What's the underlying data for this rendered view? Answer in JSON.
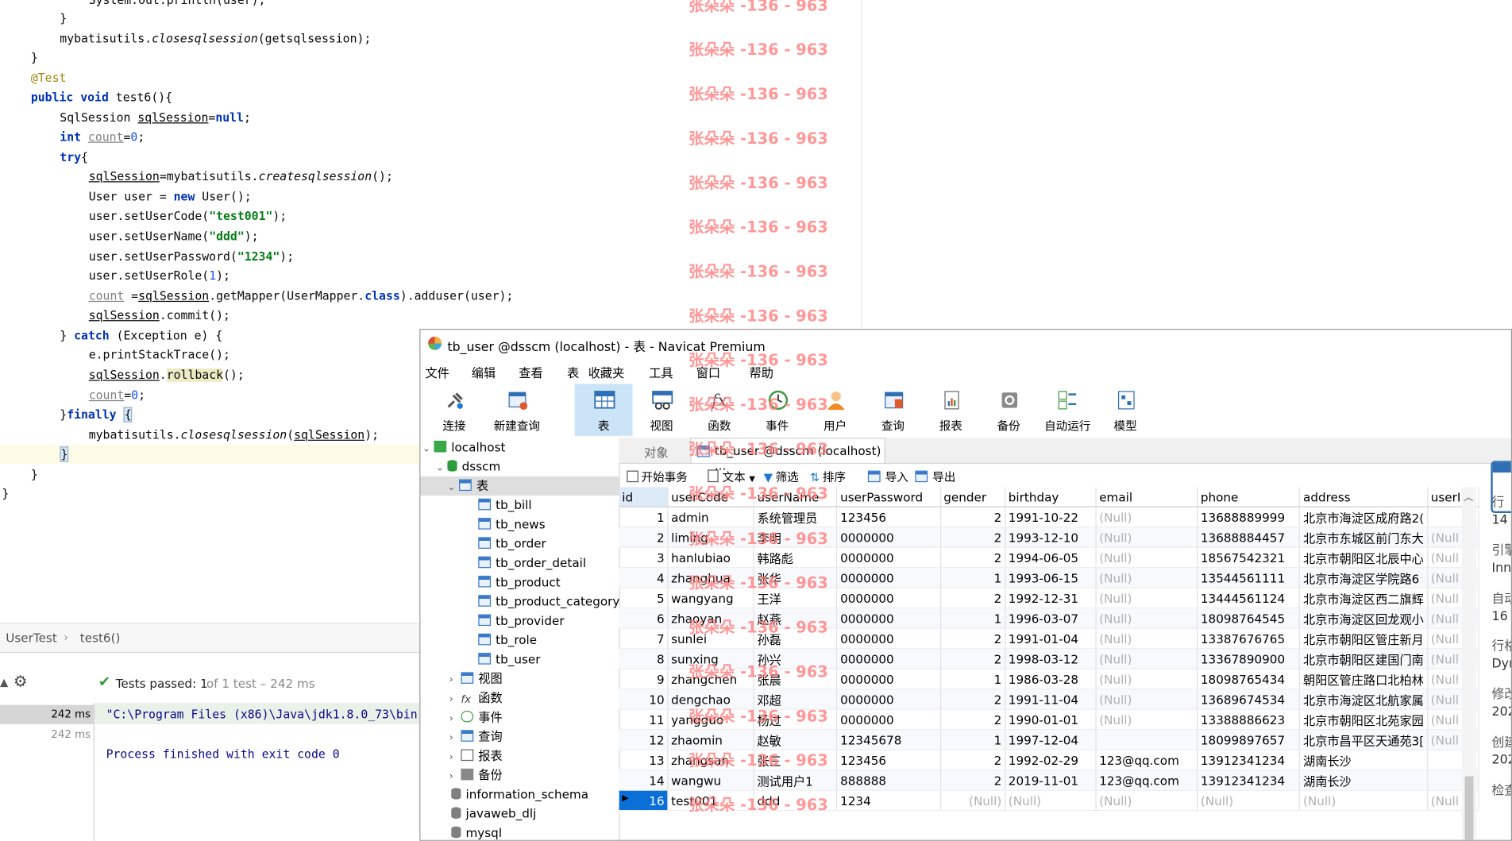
{
  "editor": {
    "lines": [
      "System.out.println(user);",
      "}",
      "mybatisutils.closesqlsession(getsqlsession);",
      "}",
      "@Test",
      "public void test6(){",
      "SqlSession sqlSession=null;",
      "int count=0;",
      "try{",
      "sqlSession=mybatisutils.createsqlsession();",
      "User user = new User();",
      "user.setUserCode(\"test001\");",
      "user.setUserName(\"ddd\");",
      "user.setUserPassword(\"1234\");",
      "user.setUserRole(1);",
      "count =sqlSession.getMapper(UserMapper.class).adduser(user);",
      "sqlSession.commit();",
      "} catch (Exception e) {",
      "e.printStackTrace();",
      "sqlSession.rollback();",
      "count=0;",
      "}finally {",
      "mybatisutils.closesqlsession(sqlSession);",
      "}",
      "}",
      "}"
    ]
  },
  "breadcrumb": {
    "class": "UserTest",
    "method": "test6()"
  },
  "runner": {
    "status_main": "Tests passed: 1",
    "status_tail": "of 1 test – 242 ms",
    "times": [
      "242 ms",
      "242 ms"
    ],
    "output": [
      "\"C:\\Program Files (x86)\\Java\\jdk1.8.0_73\\bin",
      "Process finished with exit code 0"
    ]
  },
  "watermark": "张朵朵 -136 - 963",
  "navicat": {
    "title": "tb_user @dsscm (localhost) - 表 - Navicat Premium",
    "menu": [
      "文件",
      "编辑",
      "查看",
      "表",
      "收藏夹",
      "工具",
      "窗口",
      "帮助"
    ],
    "toolbar": [
      "连接",
      "新建查询",
      "表",
      "视图",
      "函数",
      "事件",
      "用户",
      "查询",
      "报表",
      "备份",
      "自动运行",
      "模型"
    ],
    "tree": {
      "server": "localhost",
      "database": "dsscm",
      "tables_folder": "表",
      "tables": [
        "tb_bill",
        "tb_news",
        "tb_order",
        "tb_order_detail",
        "tb_product",
        "tb_product_category",
        "tb_provider",
        "tb_role",
        "tb_user"
      ],
      "folders": [
        "视图",
        "函数",
        "事件",
        "查询",
        "报表",
        "备份"
      ],
      "other_dbs": [
        "information_schema",
        "javaweb_dlj",
        "mysql"
      ]
    },
    "tabs": {
      "objects": "对象",
      "active": "tb_user @dsscm (localhost) ..."
    },
    "grid_toolbar": [
      "开始事务",
      "文本",
      "筛选",
      "排序",
      "导入",
      "导出"
    ],
    "columns": [
      "id",
      "userCode",
      "userName",
      "userPassword",
      "gender",
      "birthday",
      "email",
      "phone",
      "address",
      "userI"
    ],
    "rows": [
      [
        "1",
        "admin",
        "系统管理员",
        "123456",
        "2",
        "1991-10-22",
        "(Null)",
        "13688889999",
        "北京市海淀区成府路2(",
        ""
      ],
      [
        "2",
        "liming",
        "李明",
        "0000000",
        "2",
        "1993-12-10",
        "(Null)",
        "13688884457",
        "北京市东城区前门东大",
        "(Null"
      ],
      [
        "3",
        "hanlubiao",
        "韩路彪",
        "0000000",
        "2",
        "1994-06-05",
        "(Null)",
        "18567542321",
        "北京市朝阳区北辰中心",
        "(Null"
      ],
      [
        "4",
        "zhanghua",
        "张华",
        "0000000",
        "1",
        "1993-06-15",
        "(Null)",
        "13544561111",
        "北京市海淀区学院路6",
        "(Null"
      ],
      [
        "5",
        "wangyang",
        "王洋",
        "0000000",
        "2",
        "1992-12-31",
        "(Null)",
        "13444561124",
        "北京市海淀区西二旗辉",
        "(Null"
      ],
      [
        "6",
        "zhaoyan",
        "赵燕",
        "0000000",
        "1",
        "1996-03-07",
        "(Null)",
        "18098764545",
        "北京市海淀区回龙观小",
        "(Null"
      ],
      [
        "7",
        "sunlei",
        "孙磊",
        "0000000",
        "2",
        "1991-01-04",
        "(Null)",
        "13387676765",
        "北京市朝阳区管庄新月",
        "(Null"
      ],
      [
        "8",
        "sunxing",
        "孙兴",
        "0000000",
        "2",
        "1998-03-12",
        "(Null)",
        "13367890900",
        "北京市朝阳区建国门南",
        "(Null"
      ],
      [
        "9",
        "zhangchen",
        "张晨",
        "0000000",
        "1",
        "1986-03-28",
        "(Null)",
        "18098765434",
        "朝阳区管庄路口北柏林",
        "(Null"
      ],
      [
        "10",
        "dengchao",
        "邓超",
        "0000000",
        "2",
        "1991-11-04",
        "(Null)",
        "13689674534",
        "北京市海淀区北航家属",
        "(Null"
      ],
      [
        "11",
        "yangguo",
        "杨过",
        "0000000",
        "2",
        "1990-01-01",
        "(Null)",
        "13388886623",
        "北京市朝阳区北苑家园",
        "(Null"
      ],
      [
        "12",
        "zhaomin",
        "赵敏",
        "12345678",
        "1",
        "1997-12-04",
        "",
        "18099897657",
        "北京市昌平区天通苑3[",
        "(Null"
      ],
      [
        "13",
        "zhangsan",
        "张三",
        "123456",
        "2",
        "1992-02-29",
        "123@qq.com",
        "13912341234",
        "湖南长沙",
        ""
      ],
      [
        "14",
        "wangwu",
        "测试用户1",
        "888888",
        "2",
        "2019-11-01",
        "123@qq.com",
        "13912341234",
        "湖南长沙",
        ""
      ],
      [
        "16",
        "test001",
        "ddd",
        "1234",
        "(Null)",
        "(Null)",
        "(Null)",
        "(Null)",
        "(Null)",
        "(Null"
      ]
    ],
    "side_labels": [
      "行",
      "14",
      "引擎",
      "Inn",
      "自动",
      "16",
      "行格",
      "Dyn",
      "修改",
      "202",
      "创建",
      "202",
      "检查"
    ]
  }
}
